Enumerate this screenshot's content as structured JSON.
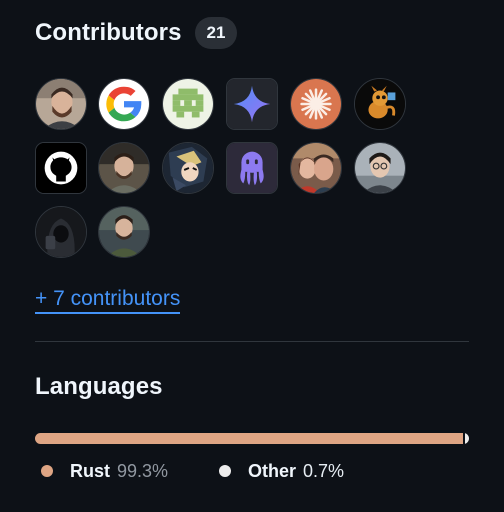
{
  "contributors": {
    "title": "Contributors",
    "count": "21",
    "more_link": "+ 7 contributors",
    "avatars": [
      {
        "name": "avatar-person-beard-1",
        "bg": "#b9a99a"
      },
      {
        "name": "avatar-google",
        "bg": "#ffffff"
      },
      {
        "name": "avatar-green-pixel",
        "bg": "#eef3e6"
      },
      {
        "name": "avatar-gemini",
        "bg": "#23262d"
      },
      {
        "name": "avatar-claude",
        "bg": "#d9764f"
      },
      {
        "name": "avatar-dragon",
        "bg": "#0a0a0a"
      },
      {
        "name": "avatar-github",
        "bg": "#000000"
      },
      {
        "name": "avatar-person-2",
        "bg": "#5c5448"
      },
      {
        "name": "avatar-anime",
        "bg": "#1d2633"
      },
      {
        "name": "avatar-octopus",
        "bg": "#2d2a3a"
      },
      {
        "name": "avatar-couple",
        "bg": "#7a5b4a"
      },
      {
        "name": "avatar-person-glasses",
        "bg": "#9aa3ab"
      },
      {
        "name": "avatar-hooded",
        "bg": "#16181c"
      },
      {
        "name": "avatar-person-3",
        "bg": "#3f4a4f"
      }
    ]
  },
  "languages": {
    "title": "Languages",
    "items": [
      {
        "name": "Rust",
        "percent_label": "99.3%",
        "percent": 99.3,
        "color": "#dea584"
      },
      {
        "name": "Other",
        "percent_label": "0.7%",
        "percent": 0.7,
        "color": "#ededed"
      }
    ]
  }
}
